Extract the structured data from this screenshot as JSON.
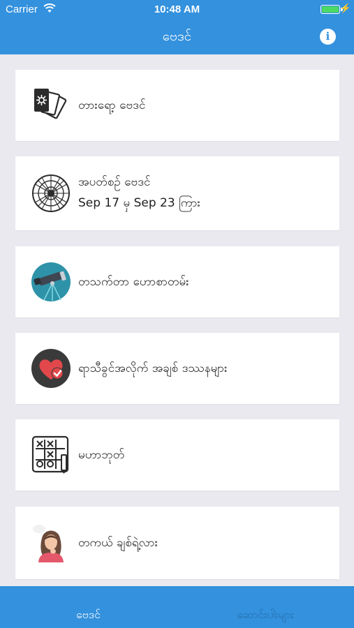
{
  "status_bar": {
    "carrier": "Carrier",
    "time": "10:48 AM",
    "battery_color": "#4cd964"
  },
  "nav": {
    "title": "ဗေဒင်",
    "info_icon": "i",
    "bar_color": "#3391de"
  },
  "menu": [
    {
      "icon": "tarot-cards-icon",
      "label": "တားရော့ ဗေဒင်"
    },
    {
      "icon": "zodiac-wheel-icon",
      "label": "အပတ်စဉ် ဗေဒင်",
      "sub": "Sep 17 မှ Sep 23 ကြား"
    },
    {
      "icon": "telescope-icon",
      "label": "တသက်တာ ဟောစာတမ်း"
    },
    {
      "icon": "heart-check-icon",
      "label": "ရာသီခွင်အလိုက် အချစ် ဒဿနများ"
    },
    {
      "icon": "tic-tac-toe-icon",
      "label": "မဟာဘုတ်"
    },
    {
      "icon": "thinking-woman-icon",
      "label": "တကယ် ချစ်ရဲ့လား"
    }
  ],
  "tabs": [
    {
      "label": "ဗေဒင်",
      "active": true
    },
    {
      "label": "ဆောင်းပါးများ",
      "active": false
    }
  ]
}
